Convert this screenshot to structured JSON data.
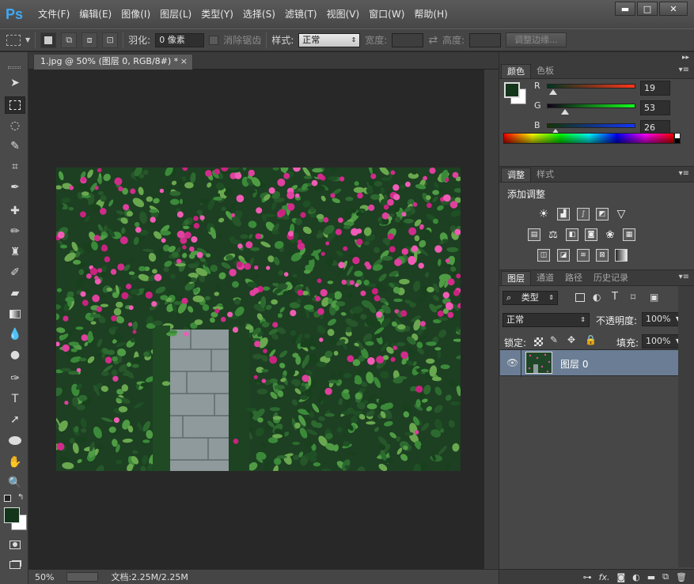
{
  "app": {
    "logo": "Ps",
    "menu": [
      "文件(F)",
      "编辑(E)",
      "图像(I)",
      "图层(L)",
      "类型(Y)",
      "选择(S)",
      "滤镜(T)",
      "视图(V)",
      "窗口(W)",
      "帮助(H)"
    ],
    "window_buttons": {
      "minimize": "▬",
      "maximize": "□",
      "close": "✕"
    }
  },
  "options": {
    "feather_label": "羽化:",
    "feather_value": "0 像素",
    "antialias_label": "消除锯齿",
    "style_label": "样式:",
    "style_value": "正常",
    "width_label": "宽度:",
    "swap_icon": "⇄",
    "height_label": "高度:",
    "refine_button": "调整边缘..."
  },
  "document": {
    "tab_title": "1.jpg @ 50% (图层 0, RGB/8#) *",
    "close": "×"
  },
  "status": {
    "zoom": "50%",
    "doc_info": "文档:2.25M/2.25M"
  },
  "color_panel": {
    "tabs": [
      "颜色",
      "色板"
    ],
    "r_label": "R",
    "r_value": "19",
    "g_label": "G",
    "g_value": "53",
    "b_label": "B",
    "b_value": "26",
    "foreground": "#13351a",
    "background": "#ffffff"
  },
  "adjust_panel": {
    "tabs": [
      "调整",
      "样式"
    ],
    "add_label": "添加调整"
  },
  "layers_panel": {
    "tabs": [
      "图层",
      "通道",
      "路径",
      "历史记录"
    ],
    "filter_label": "类型",
    "blend_mode": "正常",
    "opacity_label": "不透明度:",
    "opacity_value": "100%",
    "lock_label": "锁定:",
    "fill_label": "填充:",
    "fill_value": "100%",
    "layer_name": "图层 0",
    "footer_icons": [
      "link-icon",
      "fx-icon",
      "mask-icon",
      "adjustment-icon",
      "folder-icon",
      "new-layer-icon",
      "trash-icon"
    ],
    "fx_text": "fx."
  },
  "colors": {
    "accent_ps": "#3fa9f5",
    "selected_layer": "#6a7d95"
  }
}
